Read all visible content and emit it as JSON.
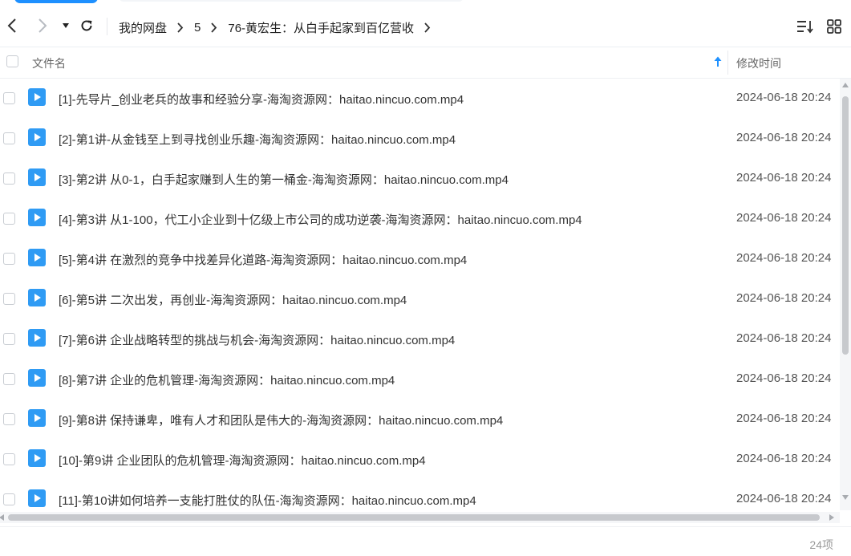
{
  "toolbar": {
    "back_icon": "chevron-left-icon",
    "forward_icon": "chevron-right-icon",
    "history_icon": "caret-down-icon",
    "refresh_icon": "refresh-icon",
    "sort_icon": "sort-list-icon",
    "view_icon": "grid-view-icon"
  },
  "breadcrumb": {
    "items": [
      {
        "label": "我的网盘"
      },
      {
        "label": "5"
      },
      {
        "label": "76-黄宏生：从白手起家到百亿营收"
      }
    ]
  },
  "list_header": {
    "name_label": "文件名",
    "time_label": "修改时间",
    "sort_icon": "arrow-up-icon"
  },
  "files": [
    {
      "name": "[1]-先导片_创业老兵的故事和经验分享-海淘资源网：haitao.nincuo.com.mp4",
      "modified": "2024-06-18 20:24"
    },
    {
      "name": "[2]-第1讲-从金钱至上到寻找创业乐趣-海淘资源网：haitao.nincuo.com.mp4",
      "modified": "2024-06-18 20:24"
    },
    {
      "name": "[3]-第2讲 从0-1，白手起家赚到人生的第一桶金-海淘资源网：haitao.nincuo.com.mp4",
      "modified": "2024-06-18 20:24"
    },
    {
      "name": "[4]-第3讲 从1-100，代工小企业到十亿级上市公司的成功逆袭-海淘资源网：haitao.nincuo.com.mp4",
      "modified": "2024-06-18 20:24"
    },
    {
      "name": "[5]-第4讲 在激烈的竞争中找差异化道路-海淘资源网：haitao.nincuo.com.mp4",
      "modified": "2024-06-18 20:24"
    },
    {
      "name": "[6]-第5讲 二次出发，再创业-海淘资源网：haitao.nincuo.com.mp4",
      "modified": "2024-06-18 20:24"
    },
    {
      "name": "[7]-第6讲 企业战略转型的挑战与机会-海淘资源网：haitao.nincuo.com.mp4",
      "modified": "2024-06-18 20:24"
    },
    {
      "name": "[8]-第7讲 企业的危机管理-海淘资源网：haitao.nincuo.com.mp4",
      "modified": "2024-06-18 20:24"
    },
    {
      "name": "[9]-第8讲 保持谦卑，唯有人才和团队是伟大的-海淘资源网：haitao.nincuo.com.mp4",
      "modified": "2024-06-18 20:24"
    },
    {
      "name": "[10]-第9讲 企业团队的危机管理-海淘资源网：haitao.nincuo.com.mp4",
      "modified": "2024-06-18 20:24"
    },
    {
      "name": "[11]-第10讲如何培养一支能打胜仗的队伍-海淘资源网：haitao.nincuo.com.mp4",
      "modified": "2024-06-18 20:24"
    }
  ],
  "footer": {
    "count_label": "24项"
  },
  "colors": {
    "accent": "#1e90ff",
    "file_icon": "#2f9bf4"
  }
}
